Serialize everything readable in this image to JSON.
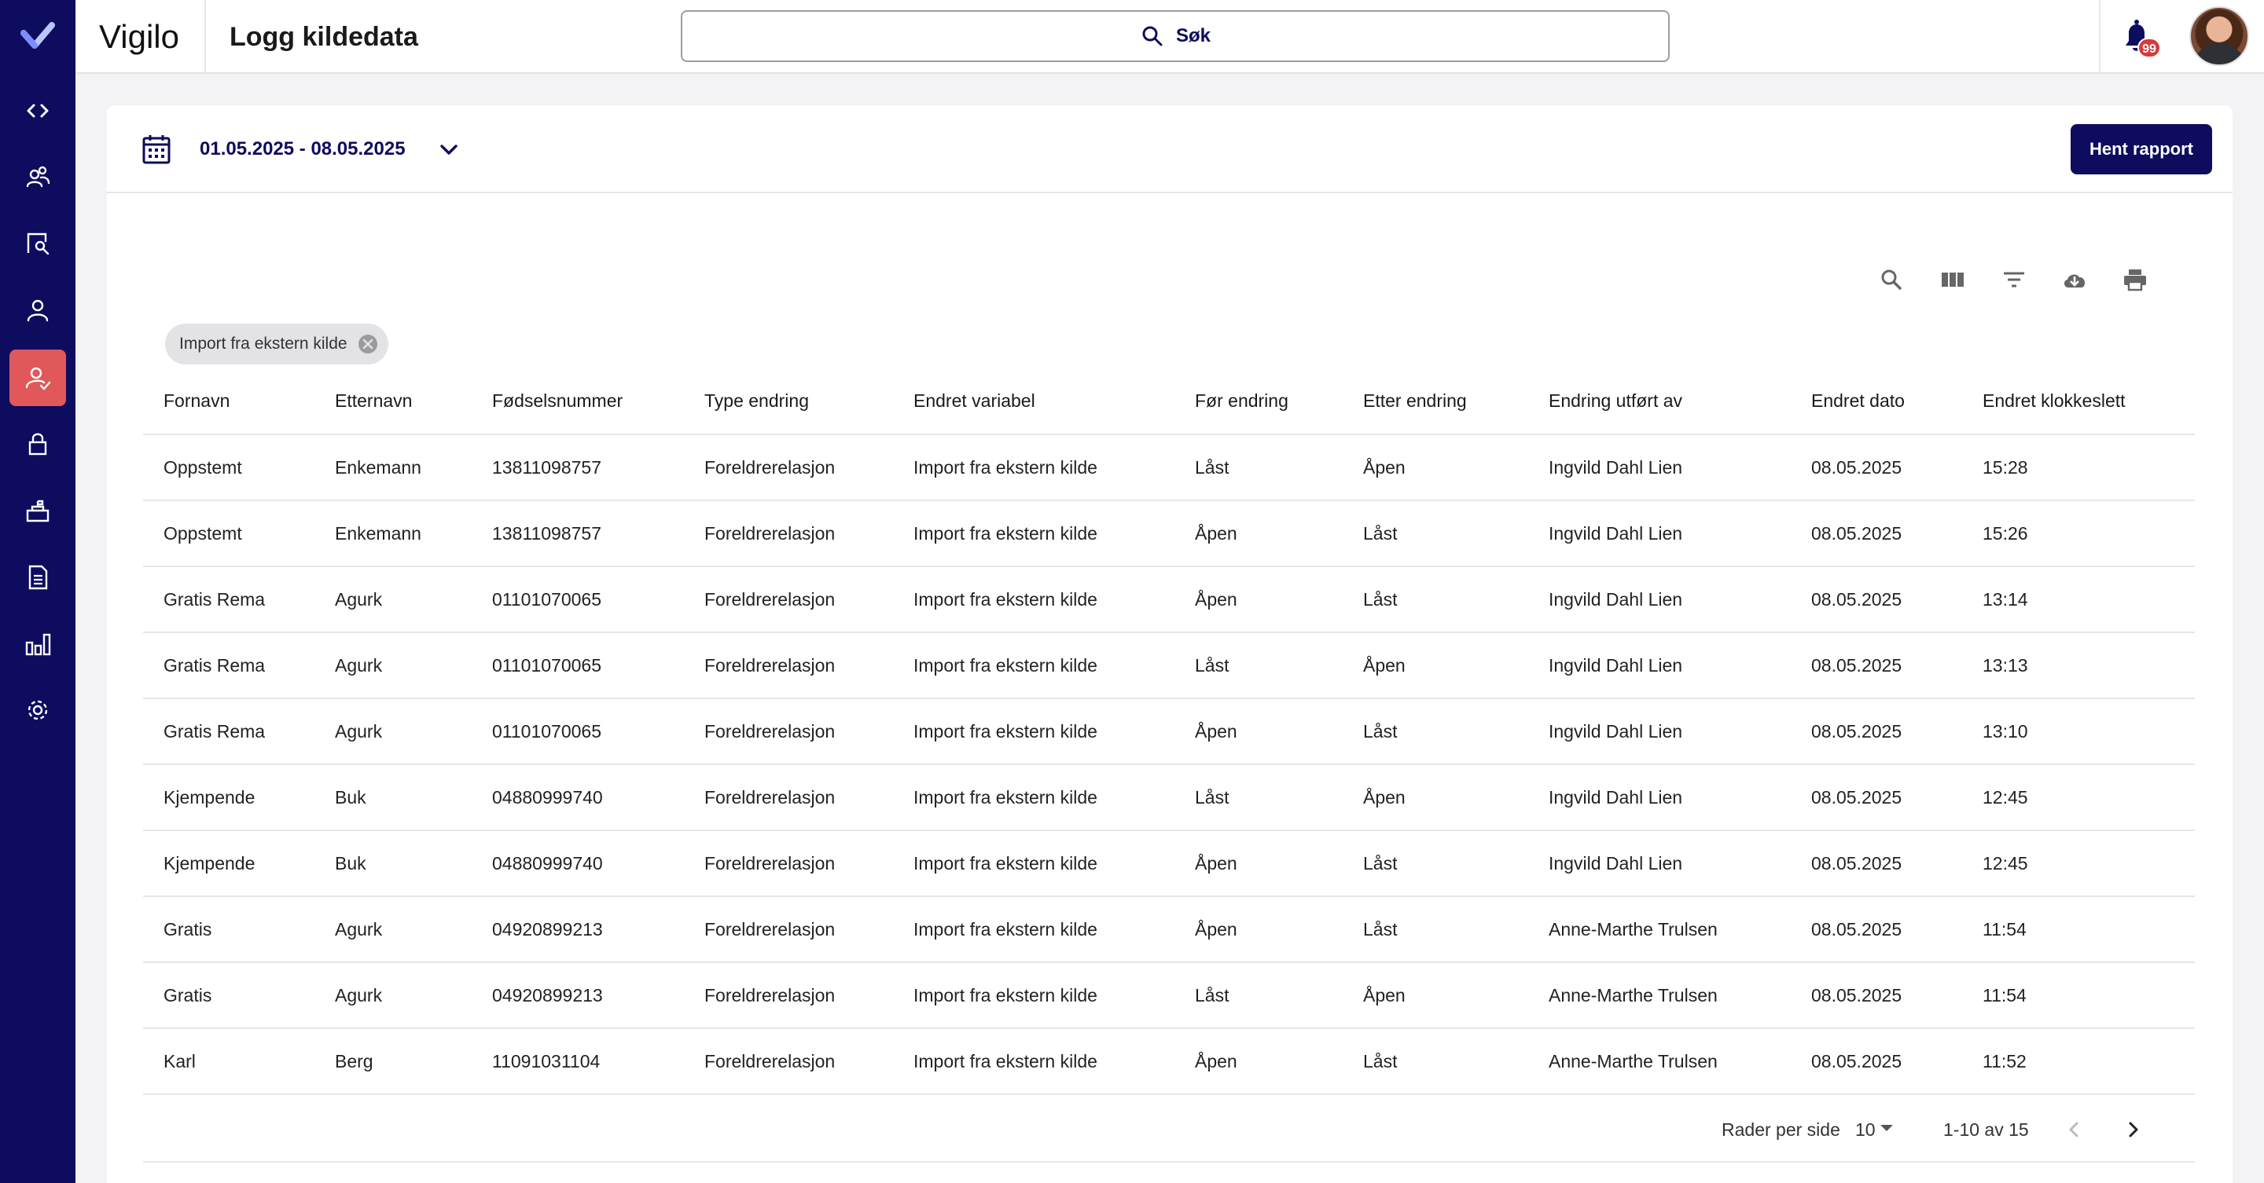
{
  "app": {
    "brand": "Vigilo",
    "page_title": "Logg kildedata"
  },
  "search": {
    "label": "Søk"
  },
  "notifications": {
    "count": "99"
  },
  "sidebar": {
    "items": [
      {
        "icon": "code-icon"
      },
      {
        "icon": "users-icon"
      },
      {
        "icon": "search-person-icon"
      },
      {
        "icon": "person-icon"
      },
      {
        "icon": "person-check-icon",
        "active": true
      },
      {
        "icon": "lock-icon"
      },
      {
        "icon": "school-icon"
      },
      {
        "icon": "document-icon"
      },
      {
        "icon": "bar-chart-icon"
      },
      {
        "icon": "gear-icon"
      }
    ]
  },
  "report": {
    "date_range": "01.05.2025 - 08.05.2025",
    "fetch_button": "Hent rapport"
  },
  "toolbar": [
    "search-icon",
    "columns-icon",
    "filter-icon",
    "download-icon",
    "print-icon"
  ],
  "filter_chip": {
    "label": "Import fra ekstern kilde"
  },
  "table": {
    "columns": [
      "Fornavn",
      "Etternavn",
      "Fødselsnummer",
      "Type endring",
      "Endret variabel",
      "Før endring",
      "Etter endring",
      "Endring utført av",
      "Endret dato",
      "Endret klokkeslett"
    ],
    "rows": [
      [
        "Oppstemt",
        "Enkemann",
        "13811098757",
        "Foreldrerelasjon",
        "Import fra ekstern kilde",
        "Låst",
        "Åpen",
        "Ingvild Dahl Lien",
        "08.05.2025",
        "15:28"
      ],
      [
        "Oppstemt",
        "Enkemann",
        "13811098757",
        "Foreldrerelasjon",
        "Import fra ekstern kilde",
        "Åpen",
        "Låst",
        "Ingvild Dahl Lien",
        "08.05.2025",
        "15:26"
      ],
      [
        "Gratis Rema",
        "Agurk",
        "01101070065",
        "Foreldrerelasjon",
        "Import fra ekstern kilde",
        "Åpen",
        "Låst",
        "Ingvild Dahl Lien",
        "08.05.2025",
        "13:14"
      ],
      [
        "Gratis Rema",
        "Agurk",
        "01101070065",
        "Foreldrerelasjon",
        "Import fra ekstern kilde",
        "Låst",
        "Åpen",
        "Ingvild Dahl Lien",
        "08.05.2025",
        "13:13"
      ],
      [
        "Gratis Rema",
        "Agurk",
        "01101070065",
        "Foreldrerelasjon",
        "Import fra ekstern kilde",
        "Åpen",
        "Låst",
        "Ingvild Dahl Lien",
        "08.05.2025",
        "13:10"
      ],
      [
        "Kjempende",
        "Buk",
        "04880999740",
        "Foreldrerelasjon",
        "Import fra ekstern kilde",
        "Låst",
        "Åpen",
        "Ingvild Dahl Lien",
        "08.05.2025",
        "12:45"
      ],
      [
        "Kjempende",
        "Buk",
        "04880999740",
        "Foreldrerelasjon",
        "Import fra ekstern kilde",
        "Åpen",
        "Låst",
        "Ingvild Dahl Lien",
        "08.05.2025",
        "12:45"
      ],
      [
        "Gratis",
        "Agurk",
        "04920899213",
        "Foreldrerelasjon",
        "Import fra ekstern kilde",
        "Åpen",
        "Låst",
        "Anne-Marthe Trulsen",
        "08.05.2025",
        "11:54"
      ],
      [
        "Gratis",
        "Agurk",
        "04920899213",
        "Foreldrerelasjon",
        "Import fra ekstern kilde",
        "Låst",
        "Åpen",
        "Anne-Marthe Trulsen",
        "08.05.2025",
        "11:54"
      ],
      [
        "Karl",
        "Berg",
        "11091031104",
        "Foreldrerelasjon",
        "Import fra ekstern kilde",
        "Åpen",
        "Låst",
        "Anne-Marthe Trulsen",
        "08.05.2025",
        "11:52"
      ]
    ]
  },
  "pagination": {
    "rows_per_page_label": "Rader per side",
    "rows_per_page": "10",
    "range": "1-10 av 15"
  },
  "colors": {
    "primary": "#0d0c5e",
    "active": "#e0585a",
    "badge": "#d93a3a"
  }
}
